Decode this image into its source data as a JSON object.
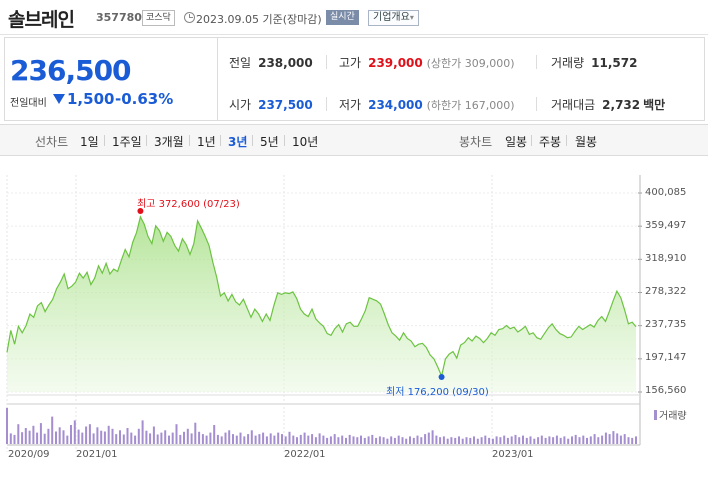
{
  "header": {
    "name": "솔브레인",
    "code": "357780",
    "market": "코스닥",
    "date": "2023.09.05",
    "basis": "기준(장마감)",
    "realtime": "실시간",
    "company_info": "기업개요"
  },
  "price": {
    "current": "236,500",
    "diff_label": "전일대비",
    "diff": "1,500",
    "rate": "-0.63%",
    "direction": "down"
  },
  "info": {
    "prev_label": "전일",
    "prev": "238,000",
    "high_label": "고가",
    "high": "239,000",
    "upper_limit": "(상한가 309,000)",
    "volume_label": "거래량",
    "volume": "11,572",
    "open_label": "시가",
    "open": "237,500",
    "low_label": "저가",
    "low": "234,000",
    "lower_limit": "(하한가 167,000)",
    "amount_label": "거래대금",
    "amount": "2,732",
    "amount_unit": "백만"
  },
  "tabs": {
    "line": "선차트",
    "periods": [
      "1일",
      "1주일",
      "3개월",
      "1년",
      "3년",
      "5년",
      "10년"
    ],
    "selected": "3년",
    "candle": "봉차트",
    "candle_periods": [
      "일봉",
      "주봉",
      "월봉"
    ]
  },
  "colors": {
    "up": "#e0101a",
    "down": "#1a5bd6",
    "line": "#6cc341",
    "volume": "#a48ed0"
  },
  "chart_data": {
    "type": "area",
    "y_ticks": [
      "400,085",
      "359,497",
      "318,910",
      "278,322",
      "237,735",
      "197,147",
      "156,560"
    ],
    "ylim": [
      156560,
      400085
    ],
    "x_ticks": [
      "2020/09",
      "2021/01",
      "2022/01",
      "2023/01"
    ],
    "high_annotation": "최고 372,600 (07/23)",
    "low_annotation": "최저 176,200 (09/30)",
    "volume_legend": "거래량",
    "series": [
      {
        "values": [
          205000,
          232000,
          215000,
          237000,
          229000,
          238000,
          252000,
          248000,
          262000,
          266000,
          255000,
          263000,
          270000,
          283000,
          291000,
          301000,
          283000,
          286000,
          291000,
          302000,
          296000,
          303000,
          288000,
          296000,
          311000,
          302000,
          314000,
          301000,
          307000,
          304000,
          318000,
          331000,
          322000,
          340000,
          352000,
          371000,
          362000,
          347000,
          338000,
          360000,
          354000,
          341000,
          352000,
          347000,
          336000,
          329000,
          344000,
          337000,
          325000,
          338000,
          366000,
          357000,
          347000,
          336000,
          315000,
          297000,
          274000,
          278000,
          268000,
          276000,
          267000,
          263000,
          270000,
          259000,
          248000,
          258000,
          252000,
          243000,
          252000,
          244000,
          262000,
          278000,
          276000,
          278000,
          277000,
          279000,
          271000,
          258000,
          252000,
          249000,
          258000,
          246000,
          241000,
          237000,
          228000,
          226000,
          234000,
          239000,
          230000,
          240000,
          242000,
          237000,
          237000,
          246000,
          256000,
          272000,
          270000,
          268000,
          264000,
          252000,
          239000,
          229000,
          225000,
          220000,
          229000,
          222000,
          219000,
          212000,
          215000,
          216000,
          211000,
          202000,
          197000,
          187000,
          176200,
          197000,
          203000,
          206000,
          198000,
          214000,
          217000,
          223000,
          219000,
          225000,
          222000,
          217000,
          222000,
          229000,
          226000,
          233000,
          234000,
          238000,
          234000,
          236000,
          230000,
          233000,
          237000,
          227000,
          229000,
          223000,
          221000,
          228000,
          235000,
          240000,
          233000,
          228000,
          226000,
          223000,
          224000,
          231000,
          237000,
          233000,
          236000,
          239000,
          236000,
          244000,
          249000,
          243000,
          255000,
          268000,
          280000,
          272000,
          257000,
          240000,
          242000,
          236500
        ]
      }
    ],
    "volume": [
      0.95,
      0.28,
      0.24,
      0.52,
      0.31,
      0.42,
      0.35,
      0.48,
      0.3,
      0.55,
      0.27,
      0.4,
      0.72,
      0.33,
      0.44,
      0.36,
      0.22,
      0.5,
      0.62,
      0.38,
      0.3,
      0.46,
      0.52,
      0.28,
      0.44,
      0.35,
      0.33,
      0.48,
      0.4,
      0.26,
      0.36,
      0.25,
      0.42,
      0.3,
      0.22,
      0.4,
      0.62,
      0.35,
      0.28,
      0.46,
      0.25,
      0.3,
      0.36,
      0.22,
      0.3,
      0.52,
      0.24,
      0.32,
      0.4,
      0.28,
      0.56,
      0.32,
      0.26,
      0.22,
      0.3,
      0.5,
      0.24,
      0.2,
      0.3,
      0.36,
      0.26,
      0.22,
      0.3,
      0.2,
      0.26,
      0.36,
      0.22,
      0.26,
      0.3,
      0.2,
      0.28,
      0.22,
      0.3,
      0.26,
      0.2,
      0.32,
      0.22,
      0.18,
      0.24,
      0.3,
      0.22,
      0.26,
      0.18,
      0.28,
      0.22,
      0.16,
      0.2,
      0.26,
      0.18,
      0.22,
      0.16,
      0.24,
      0.2,
      0.18,
      0.22,
      0.16,
      0.2,
      0.24,
      0.16,
      0.2,
      0.18,
      0.14,
      0.2,
      0.16,
      0.22,
      0.18,
      0.14,
      0.2,
      0.16,
      0.22,
      0.18,
      0.26,
      0.3,
      0.36,
      0.22,
      0.18,
      0.2,
      0.14,
      0.18,
      0.16,
      0.2,
      0.14,
      0.18,
      0.16,
      0.2,
      0.14,
      0.18,
      0.22,
      0.16,
      0.14,
      0.2,
      0.18,
      0.22,
      0.16,
      0.2,
      0.24,
      0.18,
      0.22,
      0.16,
      0.2,
      0.14,
      0.18,
      0.22,
      0.16,
      0.2,
      0.18,
      0.22,
      0.16,
      0.2,
      0.14,
      0.2,
      0.24,
      0.18,
      0.22,
      0.16,
      0.2,
      0.26,
      0.18,
      0.22,
      0.3,
      0.26,
      0.34,
      0.28,
      0.22,
      0.26,
      0.18,
      0.16,
      0.2
    ]
  }
}
